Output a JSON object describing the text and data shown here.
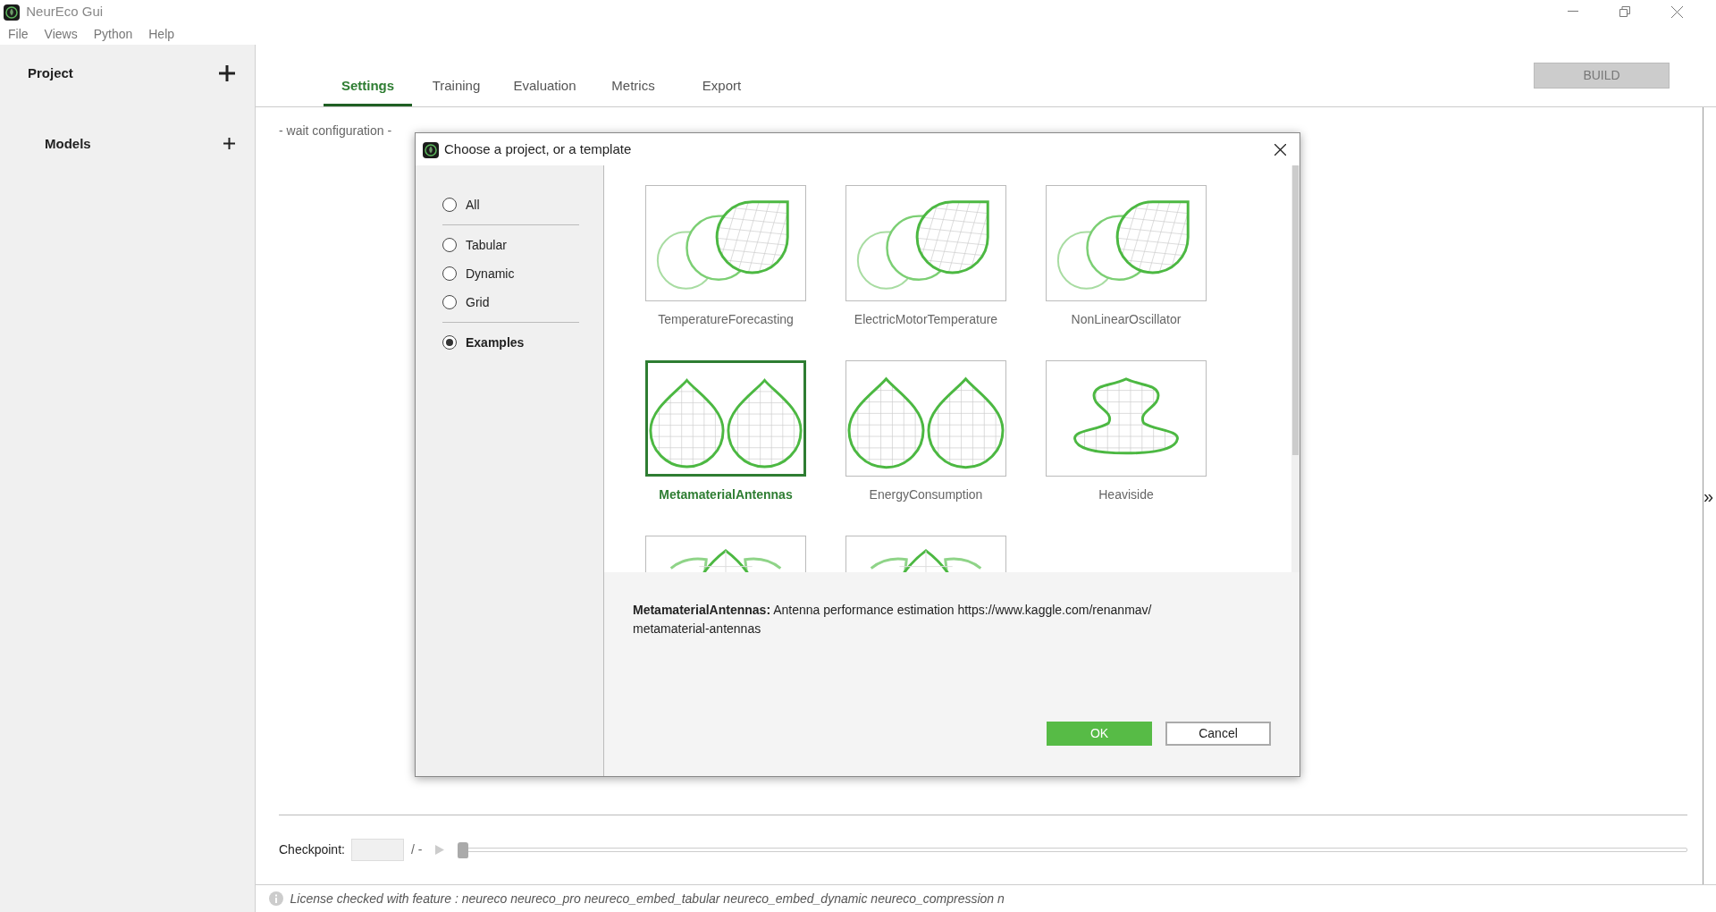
{
  "window": {
    "title": "NeurEco Gui"
  },
  "menu": [
    "File",
    "Views",
    "Python",
    "Help"
  ],
  "sidebar": {
    "sections": [
      {
        "label": "Project"
      },
      {
        "label": "Models"
      }
    ]
  },
  "tabs": [
    {
      "label": "Settings",
      "selected": true
    },
    {
      "label": "Training",
      "selected": false
    },
    {
      "label": "Evaluation",
      "selected": false
    },
    {
      "label": "Metrics",
      "selected": false
    },
    {
      "label": "Export",
      "selected": false
    }
  ],
  "build_button": {
    "label": "BUILD",
    "disabled": true
  },
  "status_text": "- wait configuration -",
  "side_toggle": "»",
  "dialog": {
    "title": "Choose a project, or a template",
    "filter_groups": [
      [
        {
          "label": "All",
          "selected": false
        }
      ],
      [
        {
          "label": "Tabular",
          "selected": false
        },
        {
          "label": "Dynamic",
          "selected": false
        },
        {
          "label": "Grid",
          "selected": false
        }
      ],
      [
        {
          "label": "Examples",
          "selected": true
        }
      ]
    ],
    "templates": [
      {
        "name": "TemperatureForecasting",
        "kind": "leaves",
        "selected": false
      },
      {
        "name": "ElectricMotorTemperature",
        "kind": "leaves",
        "selected": false
      },
      {
        "name": "NonLinearOscillator",
        "kind": "leaves",
        "selected": false
      },
      {
        "name": "MetamaterialAntennas",
        "kind": "drops",
        "selected": true
      },
      {
        "name": "EnergyConsumption",
        "kind": "drops",
        "selected": false
      },
      {
        "name": "Heaviside",
        "kind": "vase",
        "selected": false
      },
      {
        "kind": "lotus",
        "selected": false
      },
      {
        "kind": "lotus",
        "selected": false
      }
    ],
    "description": "**MetamaterialAntennas:** Antenna performance estimation https://www.kaggle.com/renanmav/ metamaterial-antennas",
    "buttons": [
      {
        "label": "OK",
        "kind": "primary"
      },
      {
        "label": "Cancel",
        "kind": "secondary"
      }
    ]
  },
  "checkpoint": {
    "label": "Checkpoint:",
    "total": "/ -",
    "slider": {
      "level": 0
    }
  },
  "status_bar": {
    "text": "License checked with feature : neureco neureco_pro neureco_embed_tabular neureco_embed_dynamic neureco_compression n"
  }
}
